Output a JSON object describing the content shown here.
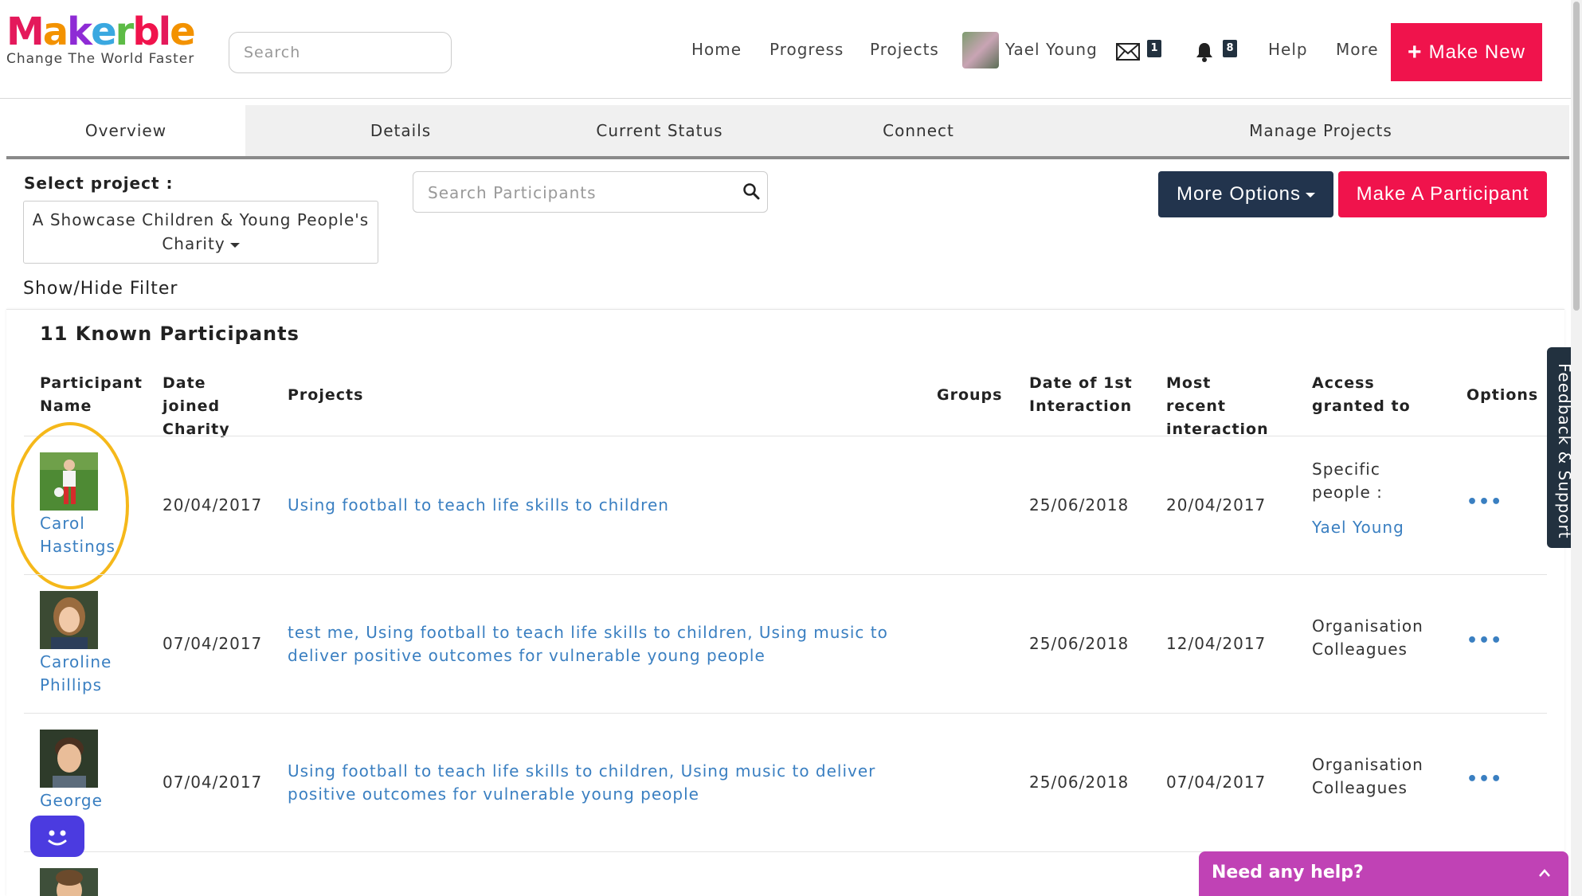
{
  "app": {
    "logo_text": "Makerble",
    "logo_colors": [
      "#e4195b",
      "#f39200",
      "#8e2bd5",
      "#3aa8e0",
      "#5dbb46",
      "#f0134c",
      "#e4195b",
      "#f39200"
    ],
    "tagline": "Change The World Faster"
  },
  "header": {
    "search_placeholder": "Search",
    "nav": [
      "Home",
      "Progress",
      "Projects"
    ],
    "user_name": "Yael Young",
    "mail_count": "1",
    "notification_count": "8",
    "help_label": "Help",
    "more_label": "More",
    "make_new_plus": "+",
    "make_new_label": "Make New"
  },
  "tabs": [
    "Overview",
    "Details",
    "Current Status",
    "Connect",
    "Manage Projects"
  ],
  "toolbar": {
    "select_project_label": "Select project :",
    "selected_project": "A Showcase Children & Young People's Charity",
    "search_participants_placeholder": "Search Participants",
    "more_options_label": "More Options",
    "make_participant_label": "Make A Participant",
    "show_hide_filter": "Show/Hide Filter"
  },
  "participants": {
    "title": "11 Known Participants",
    "columns": {
      "name": "Participant Name",
      "date_joined": "Date joined Charity",
      "projects": "Projects",
      "groups": "Groups",
      "first_interaction": "Date of 1st Interaction",
      "recent_interaction": "Most recent interaction",
      "access": "Access granted to",
      "options": "Options"
    },
    "rows": [
      {
        "name": "Carol Hastings",
        "date_joined": "20/04/2017",
        "projects": "Using football to teach life skills to children",
        "groups": "",
        "first_interaction": "25/06/2018",
        "recent_interaction": "20/04/2017",
        "access": "Specific people :",
        "access_person": "Yael Young",
        "options": "•••"
      },
      {
        "name": "Caroline Phillips",
        "date_joined": "07/04/2017",
        "projects": "test me, Using football to teach life skills to children, Using music to deliver positive outcomes for vulnerable young people",
        "groups": "",
        "first_interaction": "25/06/2018",
        "recent_interaction": "12/04/2017",
        "access": "Organisation Colleagues",
        "options": "•••"
      },
      {
        "name": "George",
        "date_joined": "07/04/2017",
        "projects": "Using football to teach life skills to children, Using music to deliver positive outcomes for vulnerable young people",
        "groups": "",
        "first_interaction": "25/06/2018",
        "recent_interaction": "07/04/2017",
        "access": "Organisation Colleagues",
        "options": "•••"
      }
    ]
  },
  "floating": {
    "feedback_label": "Feedback & Support",
    "help_label": "Need any help?"
  },
  "colors": {
    "brand_red": "#f0134c",
    "navy": "#22344d",
    "link_blue": "#3a7fc1",
    "highlight": "#f5b81a",
    "help_purple": "#c042b5",
    "bot_blue": "#4b3be0"
  }
}
